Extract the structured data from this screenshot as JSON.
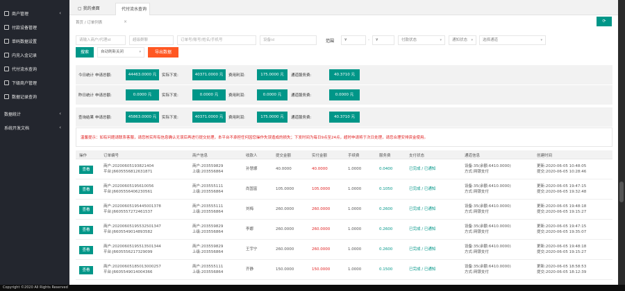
{
  "sidebar": {
    "items": [
      {
        "label": "商户管理",
        "chev": true
      },
      {
        "label": "付款设备管理",
        "chev": false
      },
      {
        "label": "单码数据设置",
        "chev": false
      },
      {
        "label": "内充入金记录",
        "chev": false
      },
      {
        "label": "代付流水查询",
        "chev": false
      },
      {
        "label": "下级商户管理",
        "chev": false
      },
      {
        "label": "数据记录查询",
        "chev": false
      },
      {
        "label": "数据统计",
        "chev": true
      },
      {
        "label": "系统开发文档",
        "chev": true
      }
    ]
  },
  "tabs": [
    {
      "label": "我的桌面"
    },
    {
      "label": "代付流水查询",
      "close": "×"
    }
  ],
  "breadcrumb": "首页 / 订单列表",
  "refresh_label": "⟳",
  "filters": {
    "merchant_placeholder": "请输入商户/代理id",
    "device_placeholder": "超级群聊",
    "order_placeholder": "订单号/账号/姓名/手机号",
    "device_id_placeholder": "设备id",
    "range_label": "范围",
    "min_placeholder": "¥",
    "max_placeholder": "¥",
    "pay_status": "付款状态",
    "notify_status": "通知状态",
    "channel": "选择通道",
    "search_btn": "搜索",
    "auto_refresh": "自动刷新关闭",
    "export_btn": "导出数据"
  },
  "stats": [
    {
      "title": "今日统计",
      "items": [
        {
          "label": "申请总额:",
          "value": "44463.0000 元"
        },
        {
          "label": "实际下发:",
          "value": "40371.0000 元"
        },
        {
          "label": "费用利润:",
          "value": "175.0000 元"
        },
        {
          "label": "通道服务费:",
          "value": "40.3710 元"
        }
      ]
    },
    {
      "title": "昨日统计",
      "items": [
        {
          "label": "申请总额:",
          "value": "0.0000 元"
        },
        {
          "label": "实际下发:",
          "value": "0.0000 元"
        },
        {
          "label": "费用利润:",
          "value": "0.0000 元"
        },
        {
          "label": "通道服务费:",
          "value": "0.0000 元"
        }
      ]
    },
    {
      "title": "查询结果",
      "items": [
        {
          "label": "申请总额:",
          "value": "45863.0000 元"
        },
        {
          "label": "实际下发:",
          "value": "40371.0000 元"
        },
        {
          "label": "费用利润:",
          "value": "175.0000 元"
        },
        {
          "label": "通道服务费:",
          "value": "40.3710 元"
        }
      ]
    }
  ],
  "notice": "温馨提示：如有问题请联系客服，请您核实所有信息确认无误后再进行提交处理，本平台不承担任何因您操作失误造成的损失；下发时间为每日9点至24点，超时申请将于次日处理，请您合理安排资金使用。",
  "table": {
    "headers": [
      "操作",
      "订单编号",
      "商户信息",
      "收款人",
      "提交金额",
      "实付金额",
      "手续费",
      "服务费",
      "支付状态",
      "通道信息",
      "创建时间"
    ],
    "rows": [
      {
        "action": "查看",
        "order1": "商户:20200605193821404",
        "order2": "平台:J6605556812631871",
        "m1": "商户:203559829",
        "m2": "上级:203556864",
        "payee": "孙慧娜",
        "submit": "40.0000",
        "paid": "40.0000",
        "fee": "1.0000",
        "svc": "0.0400",
        "status": "已完成 / 已通知",
        "ch1": "设备:35(余额:6410.0000)",
        "ch2": "方式:网银支付",
        "t1": "更新:2020-06-05 10:48:05",
        "t2": "提交:2020-06-05 10:28:46"
      },
      {
        "action": "查看",
        "order1": "商户:20200605195610056",
        "order2": "平台:J6605556406230561",
        "m1": "商户:203555111",
        "m2": "上级:203556864",
        "payee": "尚国富",
        "submit": "105.0000",
        "paid": "105.0000",
        "fee": "1.0000",
        "svc": "0.1050",
        "status": "已完成 / 已通知",
        "ch1": "设备:35(余额:6410.0000)",
        "ch2": "方式:网银支付",
        "t1": "更新:2020-06-05 19:47:15",
        "t2": "提交:2020-06-05 19:32:48"
      },
      {
        "action": "查看",
        "order1": "商户:20200605195445001378",
        "order2": "平台:J6605557272461537",
        "m1": "商户:203555111",
        "m2": "上级:203556864",
        "payee": "刘梅",
        "submit": "260.0000",
        "paid": "260.0000",
        "fee": "1.0000",
        "svc": "0.2600",
        "status": "已完成 / 已通知",
        "ch1": "设备:35(余额:6410.0000)",
        "ch2": "方式:网银支付",
        "t1": "更新:2020-06-05 19:48:18",
        "t2": "提交:2020-06-05 19:15:27"
      },
      {
        "action": "查看",
        "order1": "商户:20200605195532501347",
        "order2": "平台:J6605549014893582",
        "m1": "商户:203559829",
        "m2": "上级:203556864",
        "payee": "李娜",
        "submit": "260.0000",
        "paid": "260.0000",
        "fee": "1.0000",
        "svc": "0.2600",
        "status": "已完成 / 已通知",
        "ch1": "设备:35(余额:6410.0000)",
        "ch2": "方式:网银支付",
        "t1": "更新:2020-06-05 19:47:15",
        "t2": "提交:2020-06-05 19:35:07"
      },
      {
        "action": "查看",
        "order1": "商户:20200605195513501344",
        "order2": "平台:J6605556217329099",
        "m1": "商户:203559829",
        "m2": "上级:203556864",
        "payee": "王宇宁",
        "submit": "260.0000",
        "paid": "260.0000",
        "fee": "1.0000",
        "svc": "0.2600",
        "status": "已完成 / 已通知",
        "ch1": "设备:35(余额:6410.0000)",
        "ch2": "方式:网银支付",
        "t1": "更新:2020-06-05 19:48:18",
        "t2": "提交:2020-06-05 19:15:27"
      },
      {
        "action": "查看",
        "order1": "商户:20200605185013000257",
        "order2": "平台:J6605549014004366",
        "m1": "商户:203555111",
        "m2": "上级:203556864",
        "payee": "齐静",
        "submit": "150.0000",
        "paid": "150.0000",
        "fee": "1.0000",
        "svc": "0.1500",
        "status": "已完成 / 已通知",
        "ch1": "设备:35(余额:6410.0000)",
        "ch2": "方式:网银支付",
        "t1": "更新:2020-06-05 18:58:53",
        "t2": "提交:2020-06-05 18:12:39"
      }
    ]
  },
  "footer": "Copyright ©2020 All Rights Reserved"
}
